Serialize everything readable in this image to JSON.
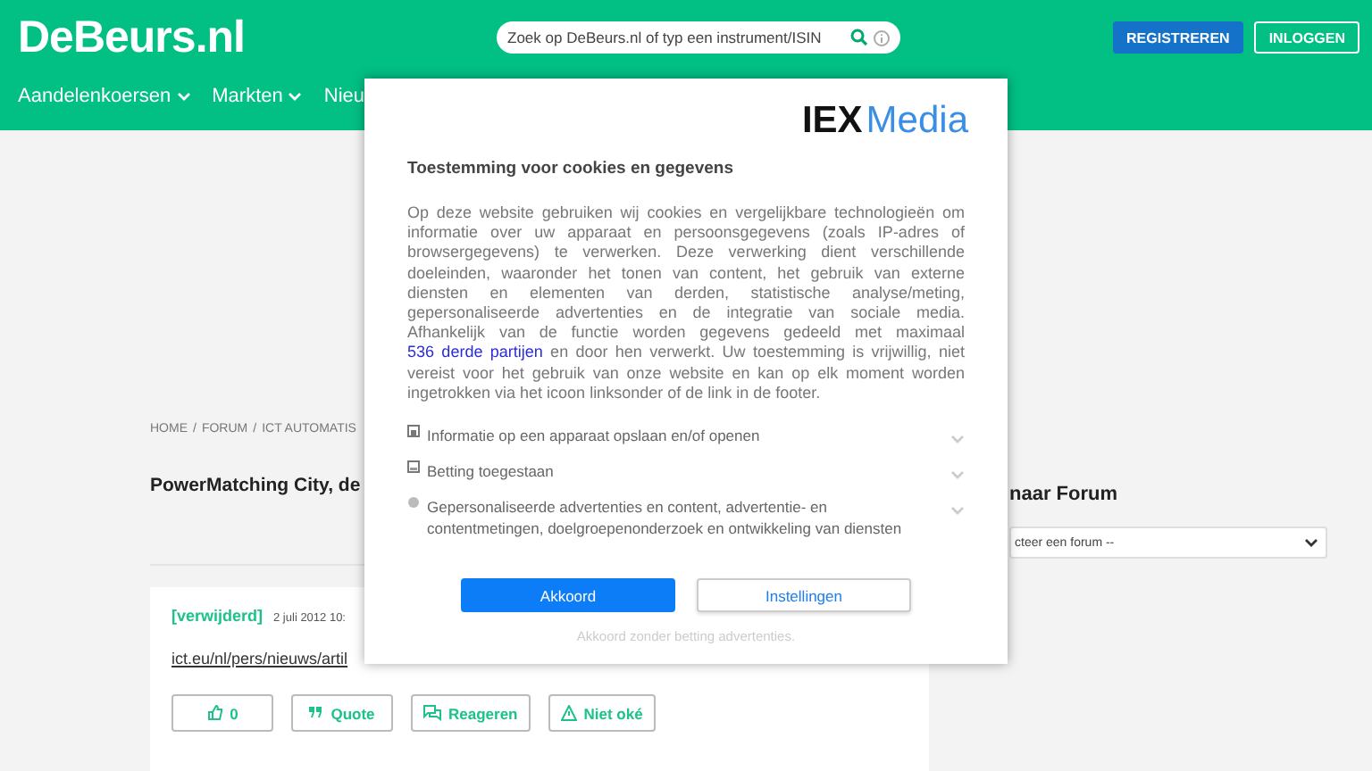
{
  "header": {
    "logo": "DeBeurs.nl",
    "search": {
      "placeholder": "Zoek op DeBeurs.nl of typ een instrument/ISIN"
    },
    "buttons": [
      {
        "label": "REGISTREREN",
        "kind": "primary"
      },
      {
        "label": "INLOGGEN",
        "kind": "outline"
      }
    ],
    "nav": [
      {
        "label": "Aandelenkoersen",
        "dropdown": true
      },
      {
        "label": "Markten",
        "dropdown": true
      },
      {
        "label": "Nieu",
        "dropdown": false
      }
    ]
  },
  "breadcrumb": {
    "separator": "/",
    "items": [
      "HOME",
      "FORUM",
      "ICT AUTOMATIS"
    ]
  },
  "title": "PowerMatching City, de",
  "post": {
    "author": "[verwijderd]",
    "date": "2 juli 2012 10:",
    "link": "ict.eu/nl/pers/nieuws/artil",
    "actions": [
      {
        "label": "0",
        "kind": "like"
      },
      {
        "label": "Quote",
        "kind": "quote"
      },
      {
        "label": "Reageren",
        "kind": "reply"
      },
      {
        "label": "Niet oké",
        "kind": "report"
      }
    ]
  },
  "sidebar": {
    "heading": "naar Forum",
    "select": "cteer een forum --"
  },
  "consent": {
    "brand": [
      "IEX",
      "Media"
    ],
    "heading": "Toestemming voor cookies en gegevens",
    "text": "Op deze website gebruiken wij cookies en vergelijkbare technologieën om informatie over uw apparaat en persoonsgegevens (zoals IP-adres of browsergegevens) te verwerken. Deze verwerking dient verschillende doeleinden, waaronder het tonen van content, het gebruik van externe diensten en elementen van derden, statistische analyse/meting, gepersonaliseerde advertenties en de integratie van sociale media. Afhankelijk van de functie worden gegevens gedeeld met maximaal ",
    "link": "536 derde partijen",
    "text_end": " en door hen verwerkt. Uw toestemming is vrijwillig, niet vereist voor het gebruik van onze website en kan op elk moment worden ingetrokken via het icoon linksonder of de link in de footer.",
    "purposes": [
      {
        "label": "Informatie op een apparaat opslaan en/of openen",
        "expanded": false,
        "kind": "storage"
      },
      {
        "label": "Betting toegestaan",
        "kind": "betting",
        "expanded": false
      },
      {
        "label": "Gepersonaliseerde advertenties en content, advertentie- en contentmetingen, doelgroepenonderzoek en ontwikkeling van diensten",
        "kind": "ads",
        "expanded": false
      }
    ],
    "buttons": [
      {
        "label": "Akkoord",
        "kind": "primary"
      },
      {
        "label": "Instellingen",
        "kind": "outline"
      }
    ],
    "footer_link": "Akkoord zonder betting advertenties."
  }
}
